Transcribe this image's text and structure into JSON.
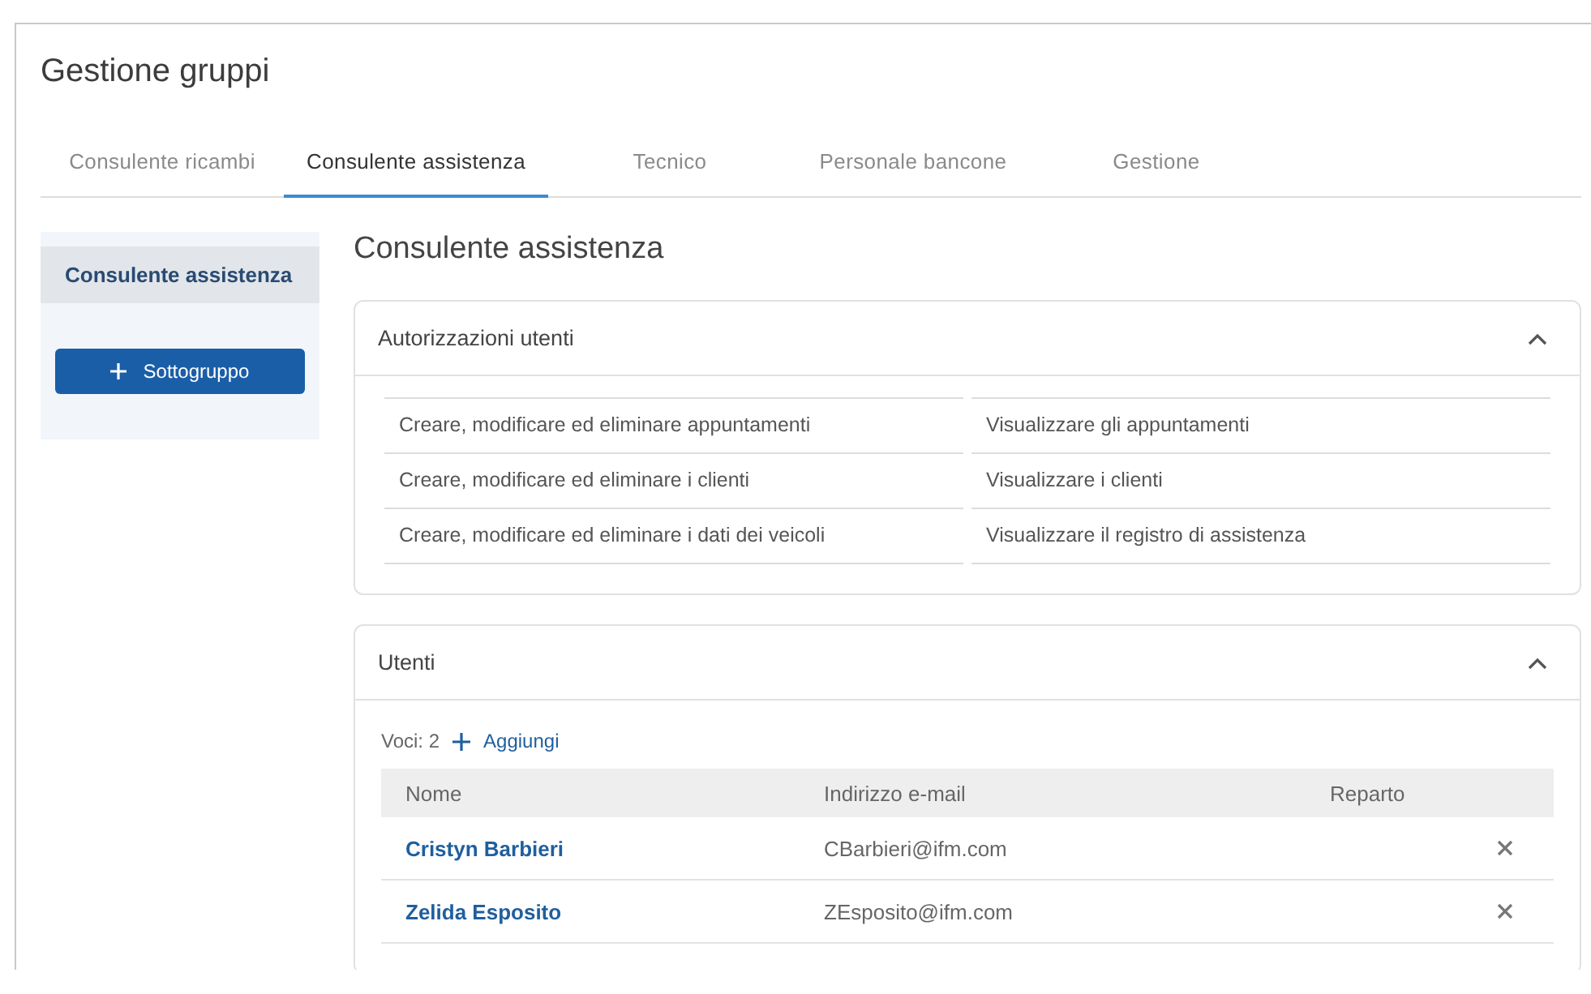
{
  "page": {
    "title": "Gestione gruppi"
  },
  "tabs": [
    {
      "label": "Consulente ricambi",
      "selected": false
    },
    {
      "label": "Consulente assistenza",
      "selected": true
    },
    {
      "label": "Tecnico",
      "selected": false
    },
    {
      "label": "Personale bancone",
      "selected": false
    },
    {
      "label": "Gestione",
      "selected": false
    }
  ],
  "sidebar": {
    "items": [
      {
        "label": "Consulente assistenza",
        "selected": true
      }
    ],
    "button": "Sottogruppo"
  },
  "section_title": "Consulente assistenza",
  "permissions_panel": {
    "title": "Autorizzazioni utenti",
    "expanded": true,
    "items": [
      "Creare, modificare ed eliminare appuntamenti",
      "Visualizzare gli appuntamenti",
      "Creare, modificare ed eliminare i clienti",
      "Visualizzare i clienti",
      "Creare, modificare ed eliminare i dati dei veicoli",
      "Visualizzare il registro di assistenza"
    ]
  },
  "users_panel": {
    "title": "Utenti",
    "expanded": true,
    "count": "Voci: 2",
    "add_label": "Aggiungi",
    "columns": [
      "Nome",
      "Indirizzo e-mail",
      "Reparto"
    ],
    "rows": [
      {
        "name": "Cristyn Barbieri",
        "email": "CBarbieri@ifm.com"
      },
      {
        "name": "Zelida Esposito",
        "email": "ZEsposito@ifm.com"
      }
    ]
  }
}
